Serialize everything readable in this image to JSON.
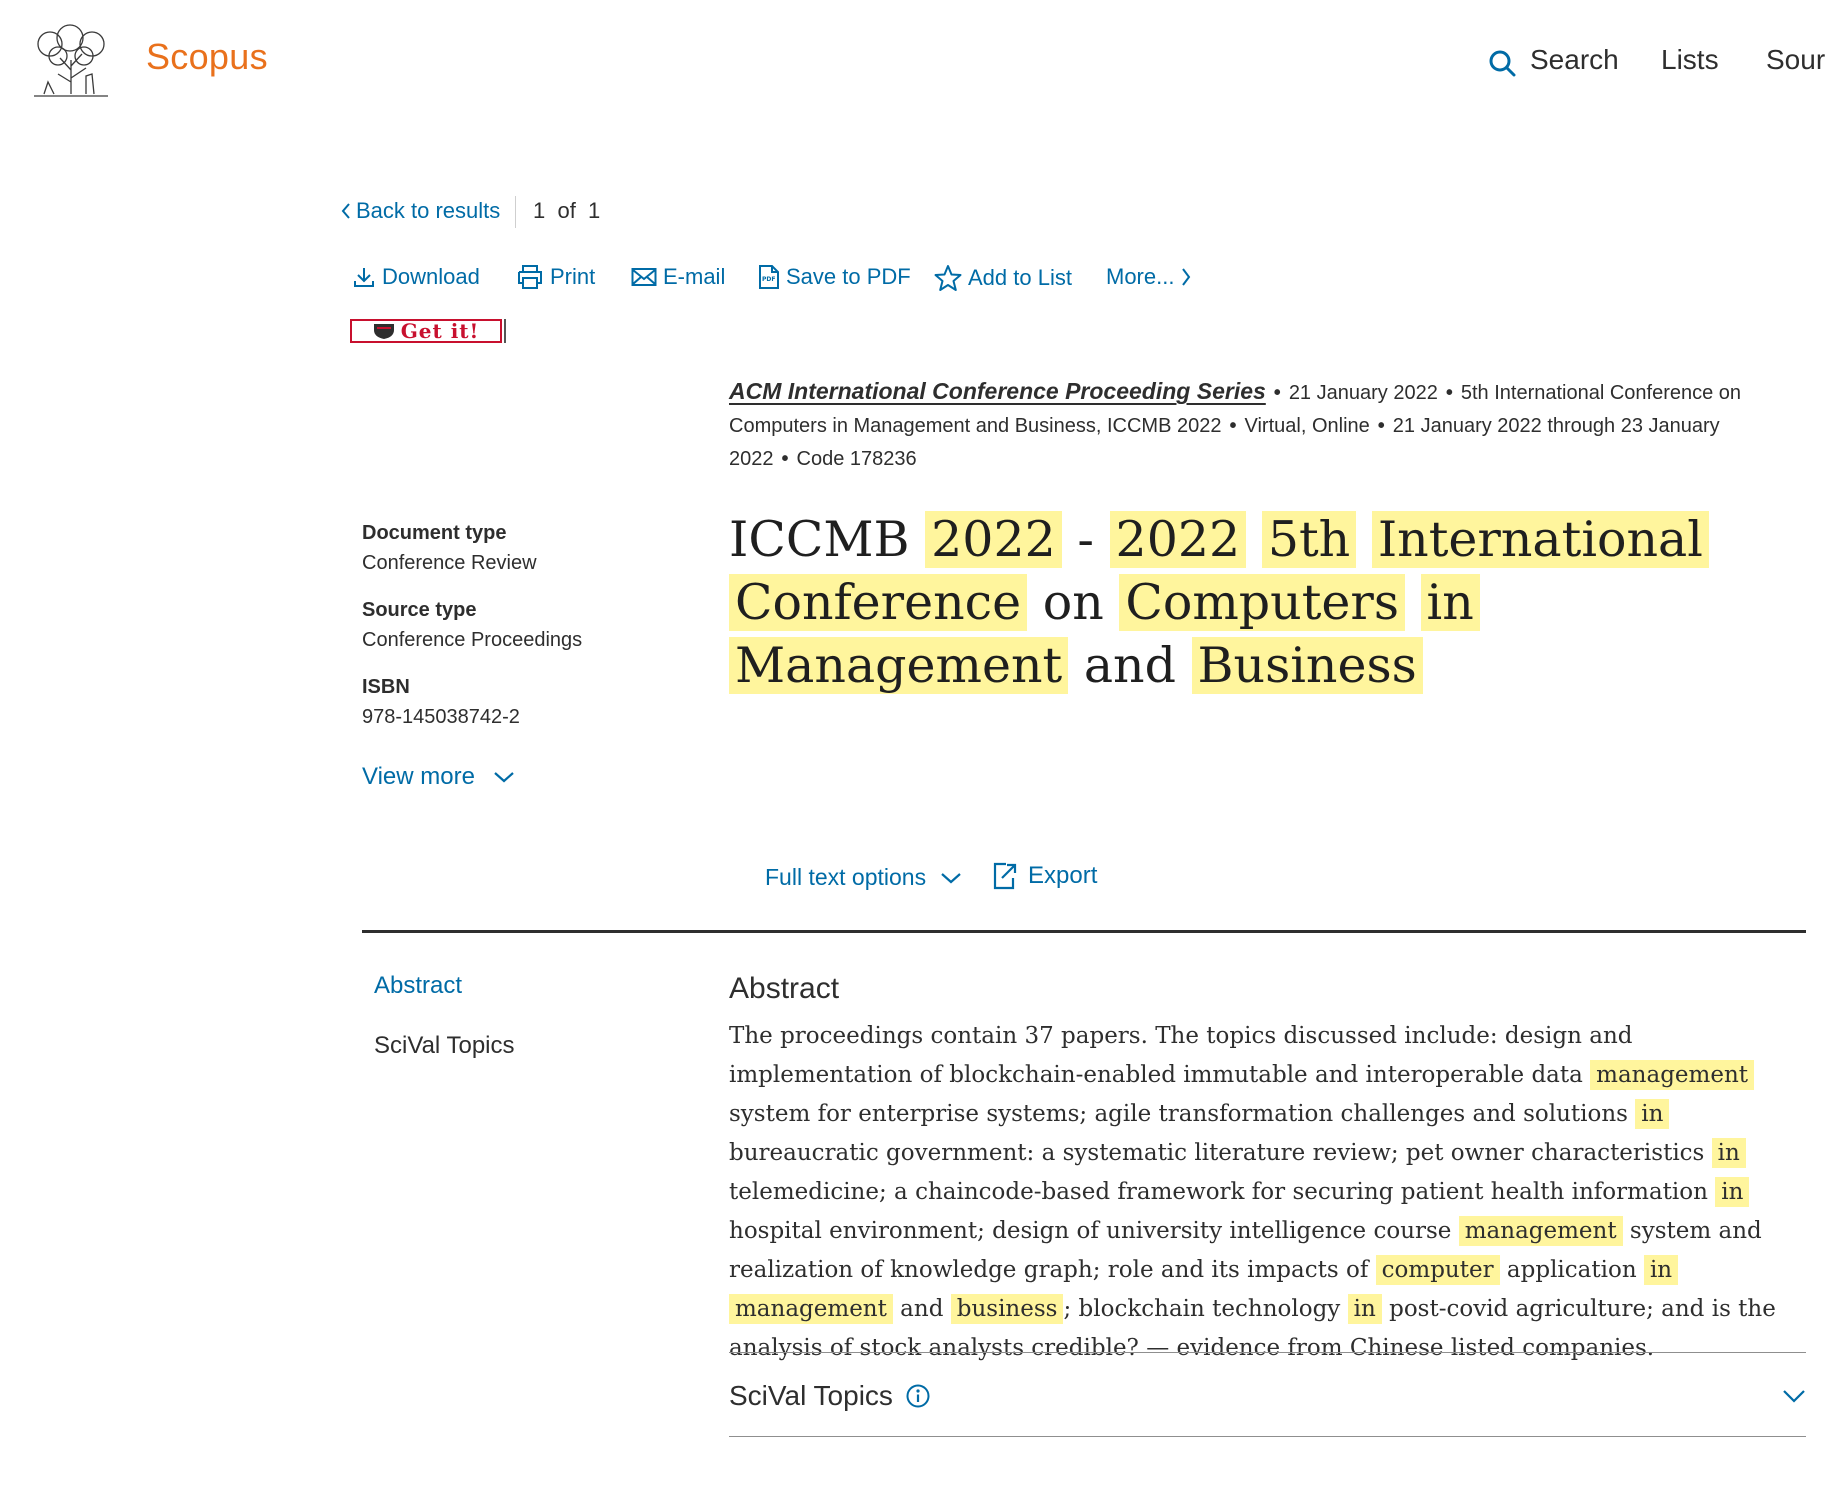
{
  "header": {
    "brand": "Scopus",
    "nav": [
      "Search",
      "Lists",
      "Sour"
    ]
  },
  "navigation": {
    "back_label": "Back to results",
    "pager": "1  of  1"
  },
  "toolbar": {
    "download": "Download",
    "print": "Print",
    "email": "E-mail",
    "save_pdf": "Save to PDF",
    "add_list": "Add to List",
    "more": "More..."
  },
  "getit": {
    "label": "Get it!"
  },
  "source": {
    "series": "ACM International Conference Proceeding Series",
    "date": "21 January 2022",
    "conference": "5th International Conference on Computers in Management and Business, ICCMB 2022",
    "location": "Virtual, Online",
    "dates": "21 January 2022 through 23 January 2022",
    "code": "Code 178236"
  },
  "title": {
    "segments": [
      {
        "t": "ICCMB",
        "h": false
      },
      {
        "t": "2022",
        "h": true
      },
      {
        "t": "-",
        "h": false
      },
      {
        "t": "2022",
        "h": true
      },
      {
        "t": "5th",
        "h": true
      },
      {
        "t": "International",
        "h": true
      },
      {
        "t": "Conference",
        "h": true
      },
      {
        "t": "on",
        "h": false
      },
      {
        "t": "Computers",
        "h": true
      },
      {
        "t": "in",
        "h": true
      },
      {
        "t": "Management",
        "h": true
      },
      {
        "t": "and",
        "h": false
      },
      {
        "t": "Business",
        "h": true
      }
    ]
  },
  "metadata": {
    "doc_type_label": "Document type",
    "doc_type": "Conference Review",
    "source_type_label": "Source type",
    "source_type": "Conference Proceedings",
    "isbn_label": "ISBN",
    "isbn": "978-145038742-2",
    "view_more": "View more"
  },
  "actions": {
    "full_text": "Full text options",
    "export": "Export"
  },
  "left_nav": {
    "abstract": "Abstract",
    "scival": "SciVal Topics"
  },
  "abstract": {
    "heading": "Abstract",
    "segments": [
      {
        "t": "The proceedings contain 37 papers. The topics discussed include: design and implementation of blockchain-enabled immutable and interoperable data ",
        "h": false
      },
      {
        "t": "management",
        "h": true
      },
      {
        "t": " system for enterprise systems; agile transformation challenges and solutions ",
        "h": false
      },
      {
        "t": "in",
        "h": true
      },
      {
        "t": " bureaucratic government: a systematic literature review; pet owner characteristics ",
        "h": false
      },
      {
        "t": "in",
        "h": true
      },
      {
        "t": " telemedicine; a chaincode-based framework for securing patient health information ",
        "h": false
      },
      {
        "t": "in",
        "h": true
      },
      {
        "t": " hospital environment; design of university intelligence course ",
        "h": false
      },
      {
        "t": "management",
        "h": true
      },
      {
        "t": " system and realization of knowledge graph; role and its impacts of ",
        "h": false
      },
      {
        "t": "computer",
        "h": true
      },
      {
        "t": " application ",
        "h": false
      },
      {
        "t": "in",
        "h": true
      },
      {
        "t": " ",
        "h": false
      },
      {
        "t": "management",
        "h": true
      },
      {
        "t": " and ",
        "h": false
      },
      {
        "t": "business",
        "h": true
      },
      {
        "t": "; blockchain technology ",
        "h": false
      },
      {
        "t": "in",
        "h": true
      },
      {
        "t": " post-covid agriculture; and is the analysis of stock analysts credible? — evidence from Chinese listed companies.",
        "h": false
      }
    ]
  },
  "scival": {
    "heading": "SciVal Topics"
  },
  "colors": {
    "brand": "#e9711c",
    "link": "#006ba6",
    "highlight": "#fff59d",
    "getit": "#c8102e"
  }
}
